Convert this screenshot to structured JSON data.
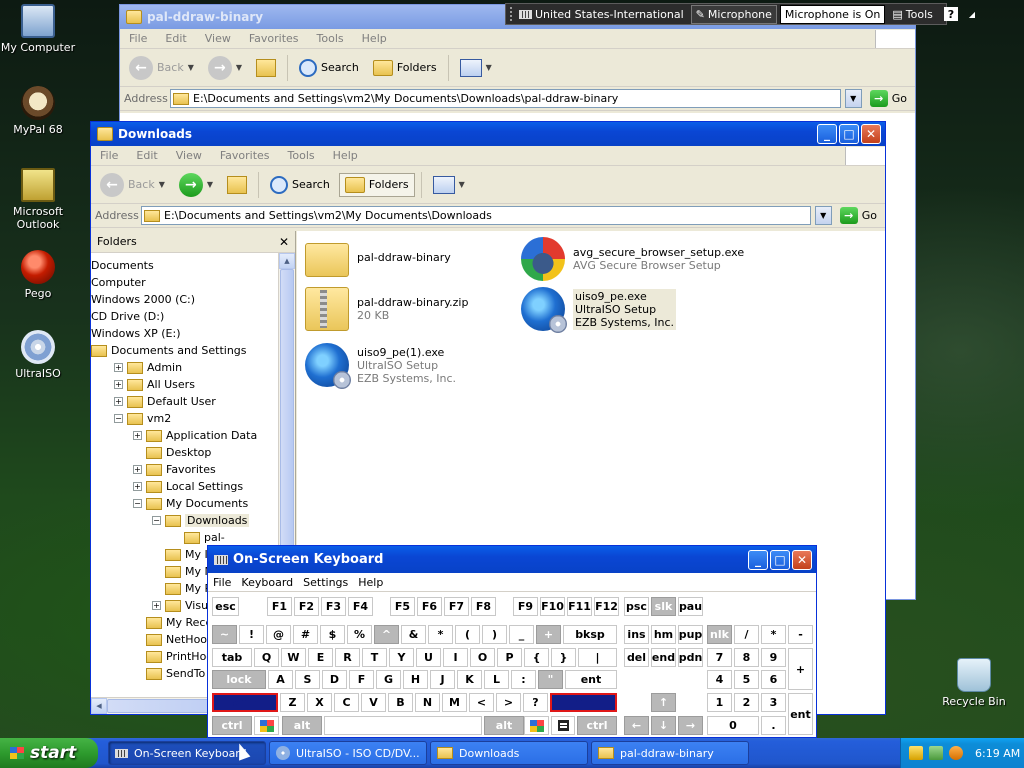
{
  "desktop": {
    "icons": [
      {
        "label": "My Computer",
        "icon": "my-computer-icon"
      },
      {
        "label": "MyPal 68",
        "icon": "mypal-browser-icon"
      },
      {
        "label": "Microsoft Outlook",
        "icon": "outlook-icon"
      },
      {
        "label": "Pego",
        "icon": "pego-icon"
      },
      {
        "label": "UltraISO",
        "icon": "ultraiso-icon"
      },
      {
        "label": "Recycle Bin",
        "icon": "recycle-bin-icon"
      }
    ]
  },
  "language_bar": {
    "language": "United States-International",
    "microphone": "Microphone",
    "status": "Microphone is On",
    "tools": "Tools",
    "help": "?"
  },
  "back_window": {
    "title": "pal-ddraw-binary",
    "menu": [
      "File",
      "Edit",
      "View",
      "Favorites",
      "Tools",
      "Help"
    ],
    "toolbar": {
      "back": "Back",
      "search": "Search",
      "folders": "Folders"
    },
    "address_label": "Address",
    "address": "E:\\Documents and Settings\\vm2\\My Documents\\Downloads\\pal-ddraw-binary",
    "go": "Go"
  },
  "front_window": {
    "title": "Downloads",
    "menu": [
      "File",
      "Edit",
      "View",
      "Favorites",
      "Tools",
      "Help"
    ],
    "toolbar": {
      "back": "Back",
      "search": "Search",
      "folders": "Folders"
    },
    "address_label": "Address",
    "address": "E:\\Documents and Settings\\vm2\\My Documents\\Downloads",
    "go": "Go",
    "folders_pane": {
      "title": "Folders",
      "tree": [
        {
          "label": "Documents",
          "level": 0
        },
        {
          "label": "Computer",
          "level": 0
        },
        {
          "label": "Windows 2000 (C:)",
          "level": 0
        },
        {
          "label": "CD Drive (D:)",
          "level": 0
        },
        {
          "label": "Windows XP (E:)",
          "level": 0
        },
        {
          "label": "Documents and Settings",
          "level": 0
        },
        {
          "label": "Admin",
          "level": 1
        },
        {
          "label": "All Users",
          "level": 1
        },
        {
          "label": "Default User",
          "level": 1
        },
        {
          "label": "vm2",
          "level": 1
        },
        {
          "label": "Application Data",
          "level": 2
        },
        {
          "label": "Desktop",
          "level": 2
        },
        {
          "label": "Favorites",
          "level": 2
        },
        {
          "label": "Local Settings",
          "level": 2
        },
        {
          "label": "My Documents",
          "level": 2
        },
        {
          "label": "Downloads",
          "level": 3
        },
        {
          "label": "pal-",
          "level": 4
        },
        {
          "label": "My ISO",
          "level": 3
        },
        {
          "label": "My Musi",
          "level": 3
        },
        {
          "label": "My Pictu",
          "level": 3
        },
        {
          "label": "Visual St",
          "level": 3
        },
        {
          "label": "My Recent D",
          "level": 2
        },
        {
          "label": "NetHood",
          "level": 2
        },
        {
          "label": "PrintHood",
          "level": 2
        },
        {
          "label": "SendTo",
          "level": 2
        }
      ]
    },
    "files": [
      {
        "name": "pal-ddraw-binary",
        "sub1": "",
        "sub2": "",
        "icon": "folder-icon"
      },
      {
        "name": "avg_secure_browser_setup.exe",
        "sub1": "AVG Secure Browser Setup",
        "sub2": "",
        "icon": "avg-installer-icon"
      },
      {
        "name": "pal-ddraw-binary.zip",
        "sub1": "20 KB",
        "sub2": "",
        "icon": "zip-folder-icon"
      },
      {
        "name": "uiso9_pe.exe",
        "sub1": "UltraISO Setup",
        "sub2": "EZB Systems, Inc.",
        "icon": "ultraiso-setup-icon"
      },
      {
        "name": "uiso9_pe(1).exe",
        "sub1": "UltraISO Setup",
        "sub2": "EZB Systems, Inc.",
        "icon": "ultraiso-setup-icon"
      }
    ]
  },
  "osk": {
    "title": "On-Screen Keyboard",
    "menu": [
      "File",
      "Keyboard",
      "Settings",
      "Help"
    ],
    "keys": {
      "row1": [
        "esc",
        "F1",
        "F2",
        "F3",
        "F4",
        "F5",
        "F6",
        "F7",
        "F8",
        "F9",
        "F10",
        "F11",
        "F12",
        "psc",
        "slk",
        "pau"
      ],
      "row2": [
        "~",
        "!",
        "@",
        "#",
        "$",
        "%",
        "^",
        "&",
        "*",
        "(",
        ")",
        "_",
        "+",
        "bksp",
        "ins",
        "hm",
        "pup",
        "nlk",
        "/",
        "*",
        "-"
      ],
      "row3": [
        "tab",
        "Q",
        "W",
        "E",
        "R",
        "T",
        "Y",
        "U",
        "I",
        "O",
        "P",
        "{",
        "}",
        "|",
        "del",
        "end",
        "pdn",
        "7",
        "8",
        "9",
        "+"
      ],
      "row4": [
        "lock",
        "A",
        "S",
        "D",
        "F",
        "G",
        "H",
        "J",
        "K",
        "L",
        ":",
        "\"",
        "ent",
        "4",
        "5",
        "6"
      ],
      "row5": [
        "shft",
        "Z",
        "X",
        "C",
        "V",
        "B",
        "N",
        "M",
        "<",
        ">",
        "?",
        "shft",
        "↑",
        "1",
        "2",
        "3",
        "ent"
      ],
      "row6": [
        "ctrl",
        "alt",
        "alt",
        "ctrl",
        "←",
        "↓",
        "→",
        "0",
        "."
      ]
    }
  },
  "taskbar": {
    "start": "start",
    "tasks": [
      {
        "label": "On-Screen Keyboard",
        "active": true
      },
      {
        "label": "UltraISO - ISO CD/DV...",
        "active": false
      },
      {
        "label": "Downloads",
        "active": false
      },
      {
        "label": "pal-ddraw-binary",
        "active": false
      }
    ],
    "clock": "6:19 AM"
  }
}
